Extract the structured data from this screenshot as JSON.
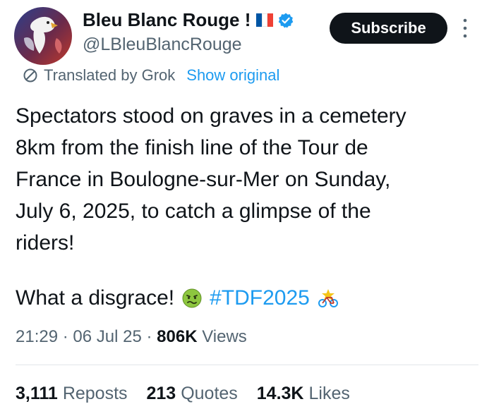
{
  "author": {
    "name": "Bleu Blanc Rouge !",
    "handle": "@LBleuBlancRouge",
    "flag_colors": [
      "#0055a4",
      "#ffffff",
      "#ef4135"
    ],
    "verified_color": "#1d9bf0"
  },
  "subscribe_label": "Subscribe",
  "translation": {
    "label": "Translated by Grok",
    "show_original": "Show original"
  },
  "tweet": {
    "lines": [
      "Spectators stood on graves in a cemetery",
      "8km from the finish line of the Tour de",
      "France in Boulogne-sur-Mer on Sunday,",
      "July 6, 2025, to catch a glimpse of the",
      "riders!"
    ],
    "closing": "What a disgrace!",
    "emoji": "nauseated-face",
    "hashtag": "#TDF2025",
    "hashtag_icon": "tour-de-france-bike-emoji"
  },
  "meta": {
    "time": "21:29",
    "date": "06 Jul 25",
    "views_count": "806K",
    "views_label": "Views"
  },
  "stats": {
    "reposts_count": "3,111",
    "reposts_label": "Reposts",
    "quotes_count": "213",
    "quotes_label": "Quotes",
    "likes_count": "14.3K",
    "likes_label": "Likes"
  },
  "colors": {
    "accent": "#1d9bf0",
    "text": "#0f1419",
    "secondary": "#536471"
  }
}
